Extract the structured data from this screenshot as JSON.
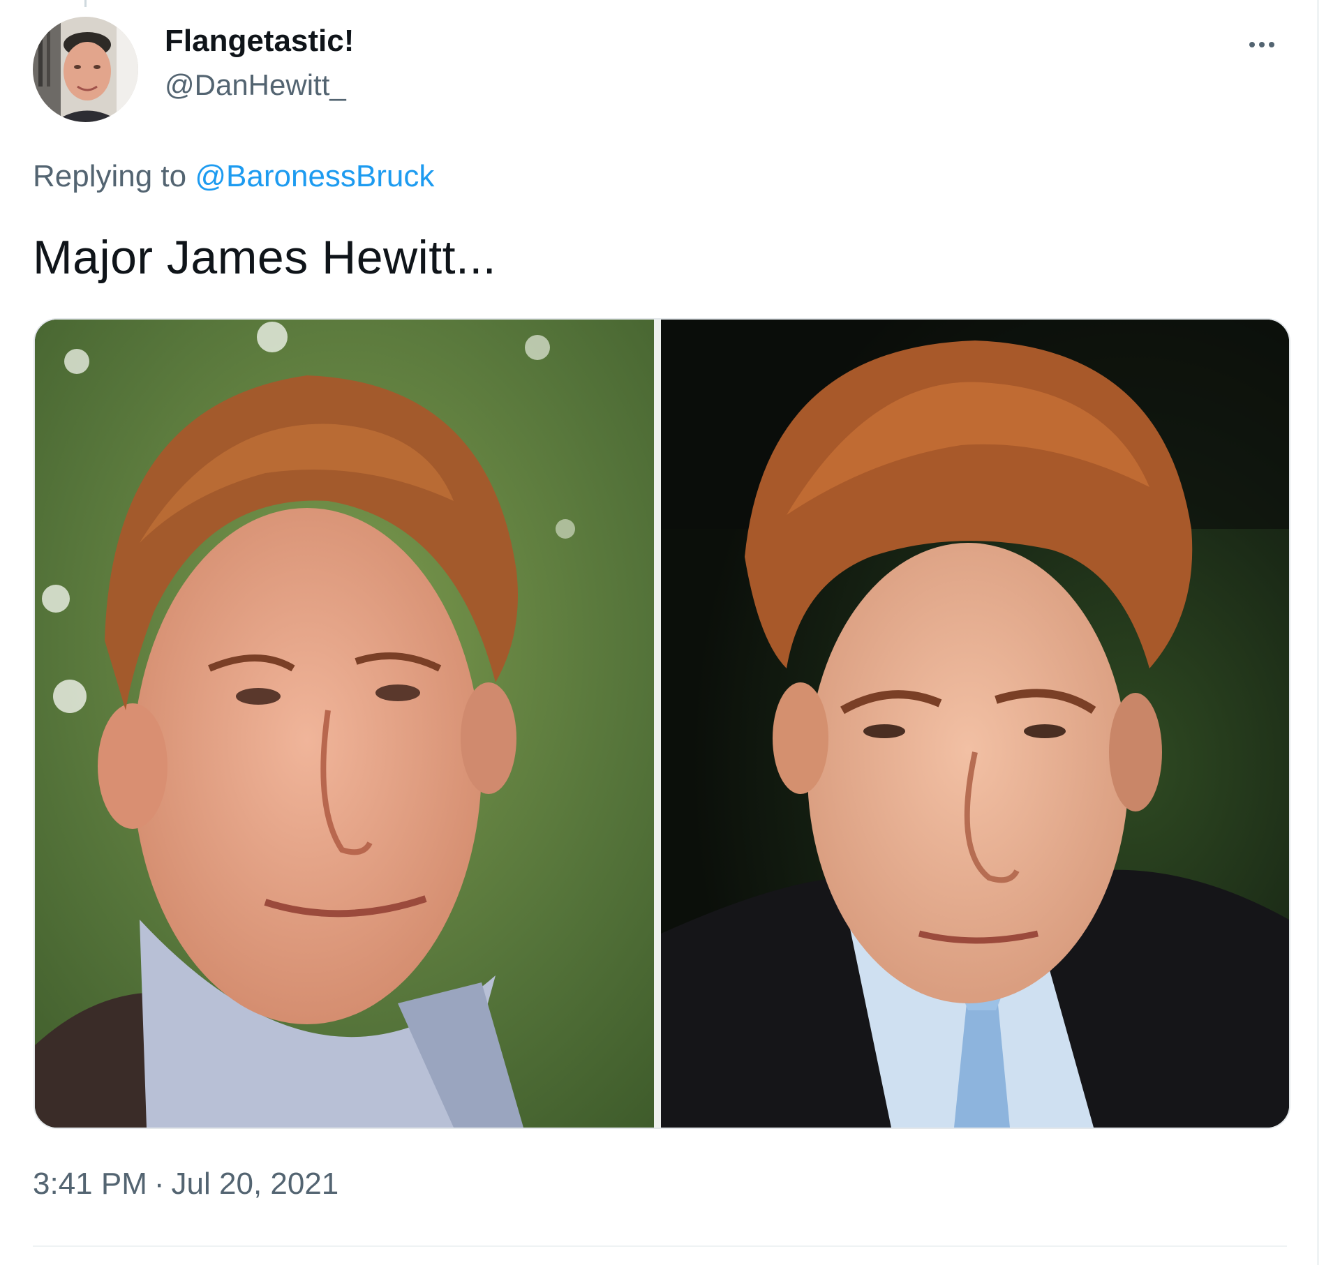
{
  "tweet": {
    "author": {
      "display_name": "Flangetastic!",
      "handle": "@DanHewitt_",
      "avatar_icon": "user-avatar-photo"
    },
    "more_icon": "more-horizontal-icon",
    "reply": {
      "prefix": "Replying to",
      "mention": "@BaronessBruck"
    },
    "text": "Major James Hewitt...",
    "media": {
      "photos": [
        {
          "content": "photo of a red-haired man smiling, green foliage background"
        },
        {
          "content": "photo of a red-haired man in dark coat and light blue tie, dark background"
        }
      ]
    },
    "time": "3:41 PM",
    "separator": "·",
    "date": "Jul 20, 2021"
  },
  "colors": {
    "text_primary": "#0f1419",
    "text_secondary": "#536471",
    "link": "#1d9bf0",
    "border": "#eff3f4"
  }
}
